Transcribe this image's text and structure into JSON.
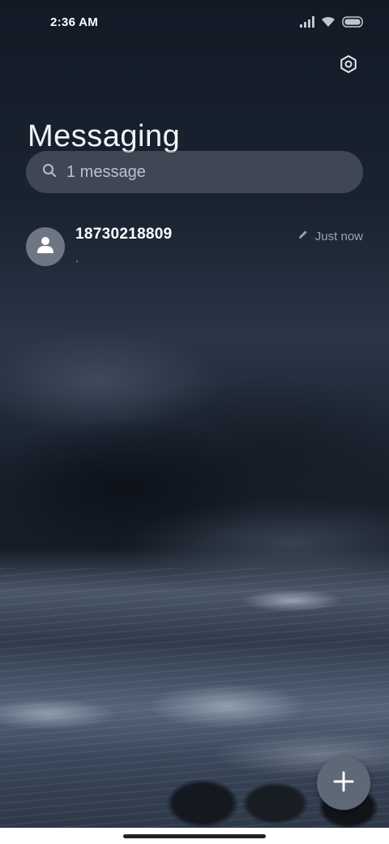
{
  "status_bar": {
    "time": "2:36 AM",
    "icons": [
      "signal-icon",
      "wifi-icon",
      "battery-icon"
    ]
  },
  "header": {
    "title": "Messaging",
    "settings_icon": "gear-icon"
  },
  "search": {
    "placeholder": "1 message",
    "icon": "search-icon"
  },
  "conversations": [
    {
      "name": "18730218809",
      "preview": ".",
      "time": "Just now",
      "draft_icon": "pencil-icon"
    }
  ],
  "fab": {
    "icon": "plus-icon"
  },
  "colors": {
    "accent": "#ffffff",
    "search_bg": "#6e7684",
    "fab_bg": "#5f6877"
  }
}
